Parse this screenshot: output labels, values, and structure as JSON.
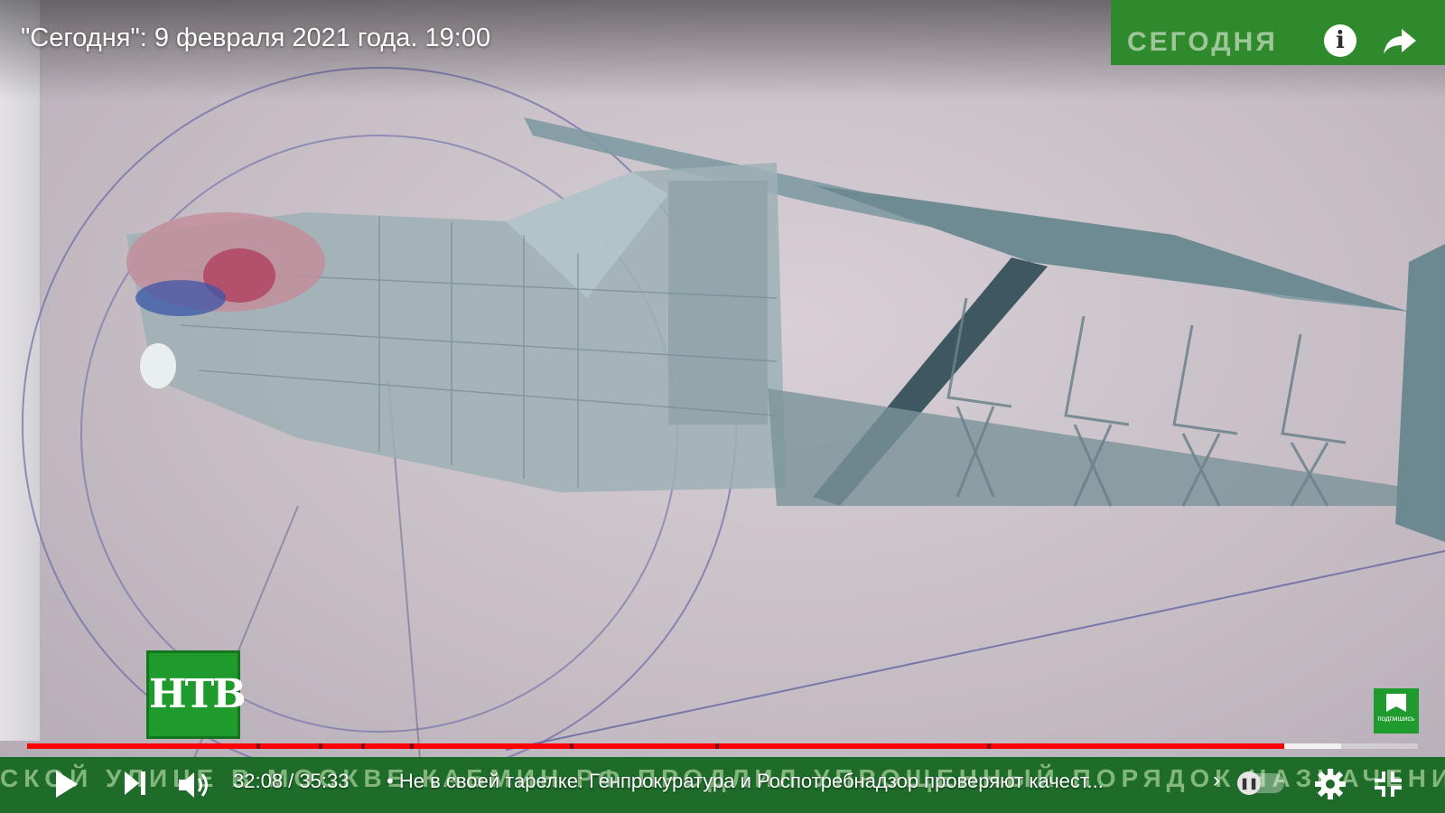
{
  "player": {
    "title": "\"Сегодня\": 9 февраля 2021 года. 19:00",
    "channel_bug_text": "СЕГОДНЯ",
    "ntv_logo_text": "НТВ",
    "subscribe_label": "подпишись",
    "ticker_text": "СКОЙ УЛИЦЕ В МОСКВЕ   КАБМИН РФ ПРОДЛИЛ УПРОЩЕННЫЙ ПОРЯДОК НАЗНАЧЕНИЯ",
    "time_display": "32:08 / 35:33",
    "chapter_separator": "•",
    "chapter_title": "Не в своей тарелке: Генпрокуратура и Роспотребнадзор проверяют качест...",
    "chapter_arrow": "›",
    "current_time_seconds": 1928,
    "duration_seconds": 2133,
    "buffered_fraction": 0.945,
    "chapter_marks_fraction": [
      0.165,
      0.21,
      0.24,
      0.275,
      0.39,
      0.495,
      0.69
    ]
  },
  "colors": {
    "progress_played": "#ff0000",
    "brand_green": "#2f8a2c",
    "ticker_green": "#1e6b2a"
  },
  "icons": {
    "play": "play-icon",
    "next": "next-icon",
    "volume": "volume-icon",
    "info": "info-icon",
    "share": "share-icon",
    "settings": "gear-icon",
    "exit_fullscreen": "exit-fullscreen-icon",
    "autoplay": "pause-icon"
  }
}
